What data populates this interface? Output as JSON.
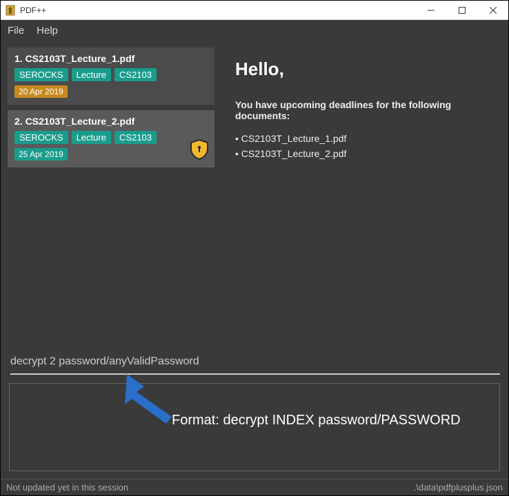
{
  "window": {
    "title": "PDF++"
  },
  "menu": {
    "file": "File",
    "help": "Help"
  },
  "list": {
    "items": [
      {
        "index_title": "1.   CS2103T_Lecture_1.pdf",
        "tags": [
          "SEROCKS",
          "Lecture",
          "CS2103"
        ],
        "date": "20 Apr 2019",
        "date_color": "orange",
        "locked": false,
        "selected": false
      },
      {
        "index_title": "2.   CS2103T_Lecture_2.pdf",
        "tags": [
          "SEROCKS",
          "Lecture",
          "CS2103"
        ],
        "date": "25 Apr 2019",
        "date_color": "teal",
        "locked": true,
        "selected": true
      }
    ]
  },
  "right": {
    "heading": "Hello,",
    "deadline_intro": "You have upcoming deadlines for the following documents:",
    "deadline_items": [
      "CS2103T_Lecture_1.pdf",
      "CS2103T_Lecture_2.pdf"
    ]
  },
  "command": {
    "value": "decrypt 2 password/anyValidPassword"
  },
  "annotation": {
    "text": "Format: decrypt INDEX password/PASSWORD"
  },
  "status": {
    "left": "Not updated yet in this session",
    "right": ".\\data\\pdfplusplus.json"
  }
}
